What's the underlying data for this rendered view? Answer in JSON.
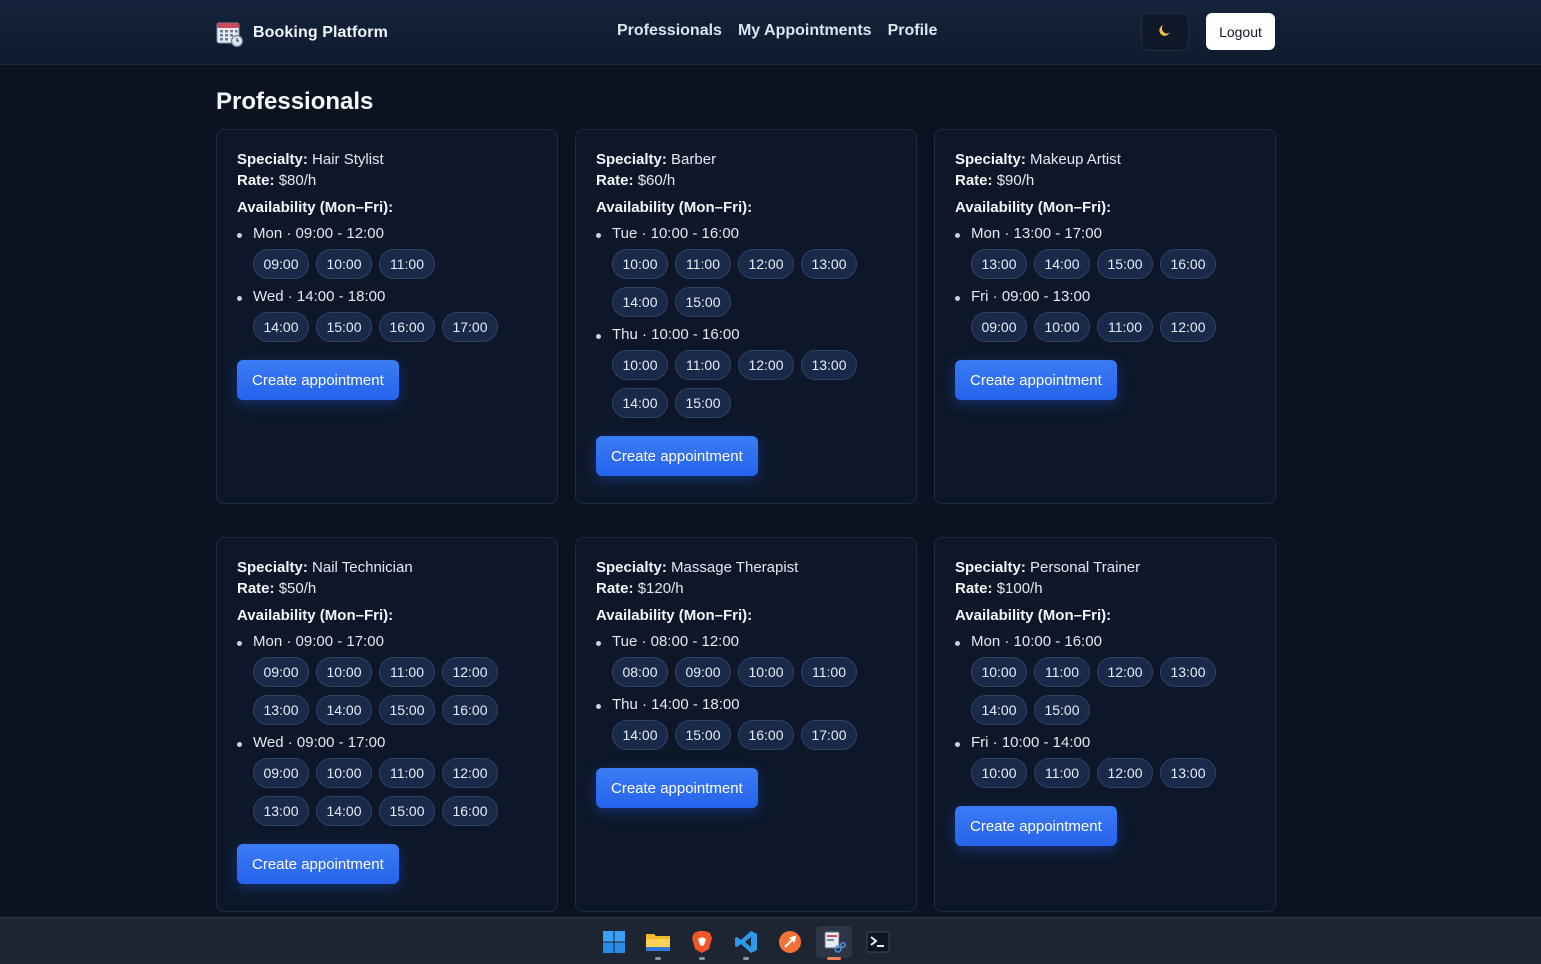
{
  "header": {
    "brand": "Booking Platform",
    "nav": [
      "Professionals",
      "My Appointments",
      "Profile"
    ],
    "theme_icon": "moon-icon",
    "logout_label": "Logout"
  },
  "page": {
    "title": "Professionals"
  },
  "labels": {
    "specialty": "Specialty:",
    "rate": "Rate:",
    "availability": "Availability (Mon–Fri):",
    "create_button": "Create appointment"
  },
  "professionals": [
    {
      "specialty": "Hair Stylist",
      "rate": "$80/h",
      "days": [
        {
          "label": "Mon · 09:00 - 12:00",
          "slots": [
            "09:00",
            "10:00",
            "11:00"
          ]
        },
        {
          "label": "Wed · 14:00 - 18:00",
          "slots": [
            "14:00",
            "15:00",
            "16:00",
            "17:00"
          ]
        }
      ]
    },
    {
      "specialty": "Barber",
      "rate": "$60/h",
      "days": [
        {
          "label": "Tue · 10:00 - 16:00",
          "slots": [
            "10:00",
            "11:00",
            "12:00",
            "13:00",
            "14:00",
            "15:00"
          ]
        },
        {
          "label": "Thu · 10:00 - 16:00",
          "slots": [
            "10:00",
            "11:00",
            "12:00",
            "13:00",
            "14:00",
            "15:00"
          ]
        }
      ]
    },
    {
      "specialty": "Makeup Artist",
      "rate": "$90/h",
      "days": [
        {
          "label": "Mon · 13:00 - 17:00",
          "slots": [
            "13:00",
            "14:00",
            "15:00",
            "16:00"
          ]
        },
        {
          "label": "Fri · 09:00 - 13:00",
          "slots": [
            "09:00",
            "10:00",
            "11:00",
            "12:00"
          ]
        }
      ]
    },
    {
      "specialty": "Nail Technician",
      "rate": "$50/h",
      "days": [
        {
          "label": "Mon · 09:00 - 17:00",
          "slots": [
            "09:00",
            "10:00",
            "11:00",
            "12:00",
            "13:00",
            "14:00",
            "15:00",
            "16:00"
          ]
        },
        {
          "label": "Wed · 09:00 - 17:00",
          "slots": [
            "09:00",
            "10:00",
            "11:00",
            "12:00",
            "13:00",
            "14:00",
            "15:00",
            "16:00"
          ]
        }
      ]
    },
    {
      "specialty": "Massage Therapist",
      "rate": "$120/h",
      "days": [
        {
          "label": "Tue · 08:00 - 12:00",
          "slots": [
            "08:00",
            "09:00",
            "10:00",
            "11:00"
          ]
        },
        {
          "label": "Thu · 14:00 - 18:00",
          "slots": [
            "14:00",
            "15:00",
            "16:00",
            "17:00"
          ]
        }
      ]
    },
    {
      "specialty": "Personal Trainer",
      "rate": "$100/h",
      "days": [
        {
          "label": "Mon · 10:00 - 16:00",
          "slots": [
            "10:00",
            "11:00",
            "12:00",
            "13:00",
            "14:00",
            "15:00"
          ]
        },
        {
          "label": "Fri · 10:00 - 14:00",
          "slots": [
            "10:00",
            "11:00",
            "12:00",
            "13:00"
          ]
        }
      ]
    }
  ],
  "taskbar": {
    "icons": [
      "windows-start-icon",
      "file-explorer-icon",
      "brave-browser-icon",
      "vscode-icon",
      "postman-icon",
      "snipping-tool-icon",
      "terminal-icon"
    ]
  },
  "colors": {
    "accent": "#2563eb",
    "background": "#0b1322",
    "card": "#0d1729",
    "slot": "#18294a"
  }
}
